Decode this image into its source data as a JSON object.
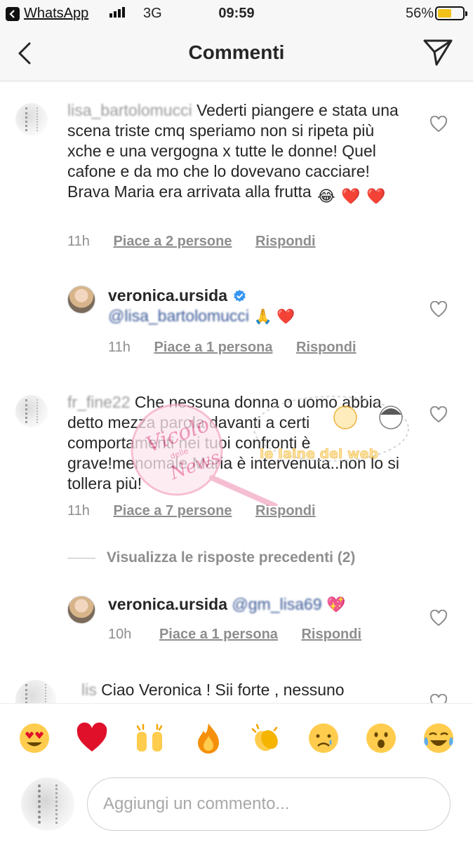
{
  "status_bar": {
    "app_name": "WhatsApp",
    "network": "3G",
    "time": "09:59",
    "battery_percent": "56%",
    "battery_level": 0.56,
    "battery_color": "#f2c21b"
  },
  "nav": {
    "title": "Commenti",
    "back_icon": "chevron-left-icon",
    "share_icon": "paper-plane-icon"
  },
  "comments": [
    {
      "username": "lisa_bartolomucci",
      "text": "Vederti piangere e stata una scena triste cmq speriamo non si ripeta più xche e una vergogna x tutte le donne! Quel cafone e da mo che lo dovevano cacciare! Brava Maria era arrivata alla frutta",
      "emojis": [
        "😂",
        "❤️",
        "❤️"
      ],
      "time": "11h",
      "likes": "Piace a 2 persone",
      "reply": "Rispondi"
    },
    {
      "username": "veronica.ursida",
      "verified": true,
      "mention": "@lisa_bartolomucci",
      "emojis": [
        "🙏",
        "❤️"
      ],
      "time": "11h",
      "likes": "Piace a 1 persona",
      "reply": "Rispondi"
    },
    {
      "username": "fr_fine22",
      "text": "Che nessuna donna o uomo abbia detto mezza parola davanti a certi comportamenti nei tuoi confronti è grave!menomale Maria è intervenuta..non lo si tollera più!",
      "time": "11h",
      "likes": "Piace a 7 persone",
      "reply": "Rispondi"
    },
    {
      "username": "veronica.ursida",
      "mention": "@gm_lisa69",
      "emojis": [
        "💖"
      ],
      "time": "10h",
      "likes": "Piace a 1 persona",
      "reply": "Rispondi"
    },
    {
      "username": "lis",
      "text": "Ciao Veronica ! Sii forte , nessuno"
    }
  ],
  "view_previous_replies": "Visualizza le risposte precedenti (2)",
  "watermark": {
    "line1": "Vicolo",
    "line2": "delle",
    "line3": "News",
    "line4": "le Iaine del web"
  },
  "emoji_bar": [
    "😍",
    "❤️",
    "🙌",
    "🔥",
    "👏",
    "😢",
    "😮",
    "😂"
  ],
  "composer": {
    "placeholder": "Aggiungi un commento..."
  }
}
